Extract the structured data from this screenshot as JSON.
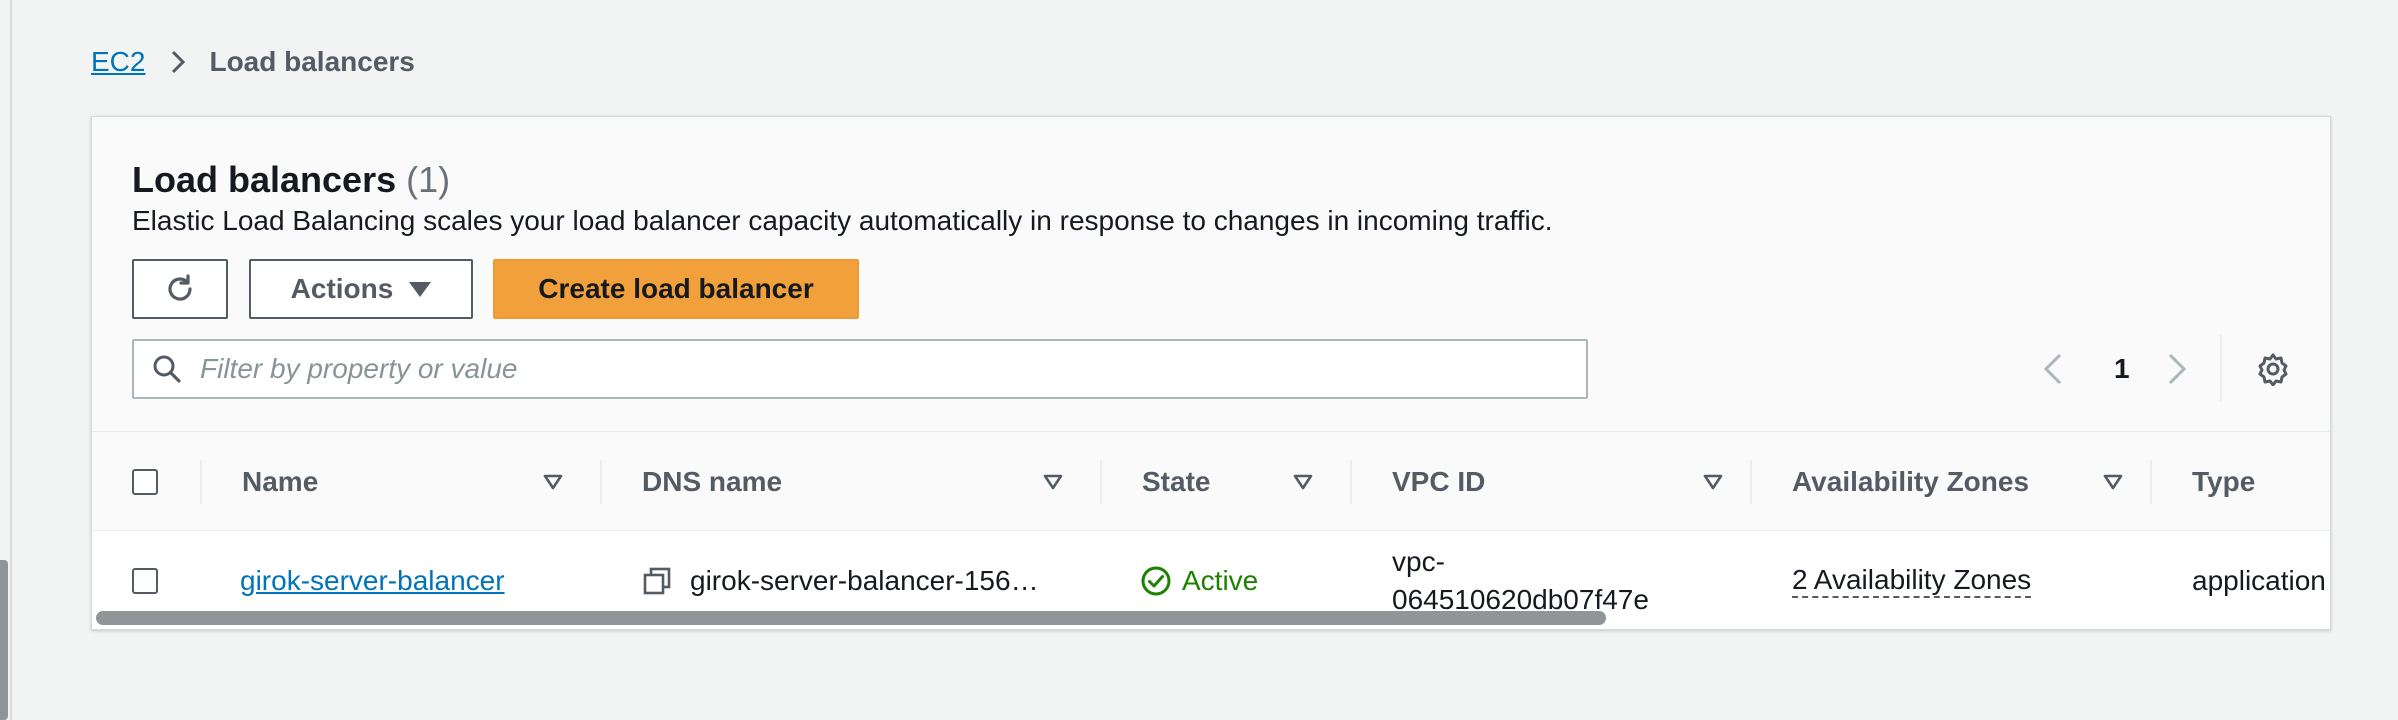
{
  "breadcrumb": {
    "root": "EC2",
    "current": "Load balancers"
  },
  "panel": {
    "title": "Load balancers",
    "count": "(1)",
    "description": "Elastic Load Balancing scales your load balancer capacity automatically in response to changes in incoming traffic."
  },
  "toolbar": {
    "refresh_icon": "refresh-icon",
    "actions_label": "Actions",
    "create_label": "Create load balancer",
    "create_color": "#f1a03b"
  },
  "search": {
    "placeholder": "Filter by property or value",
    "value": ""
  },
  "pagination": {
    "current_page": "1"
  },
  "table": {
    "columns": [
      "Name",
      "DNS name",
      "State",
      "VPC ID",
      "Availability Zones",
      "Type"
    ],
    "rows": [
      {
        "name": "girok-server-balancer",
        "dns_name": "girok-server-balancer-156…",
        "state": "Active",
        "vpc_id_line1": "vpc-",
        "vpc_id_line2": "064510620db07f47e",
        "availability_zones": "2 Availability Zones",
        "type": "application"
      }
    ]
  },
  "colors": {
    "link": "#0073bb",
    "active": "#1d8102"
  }
}
